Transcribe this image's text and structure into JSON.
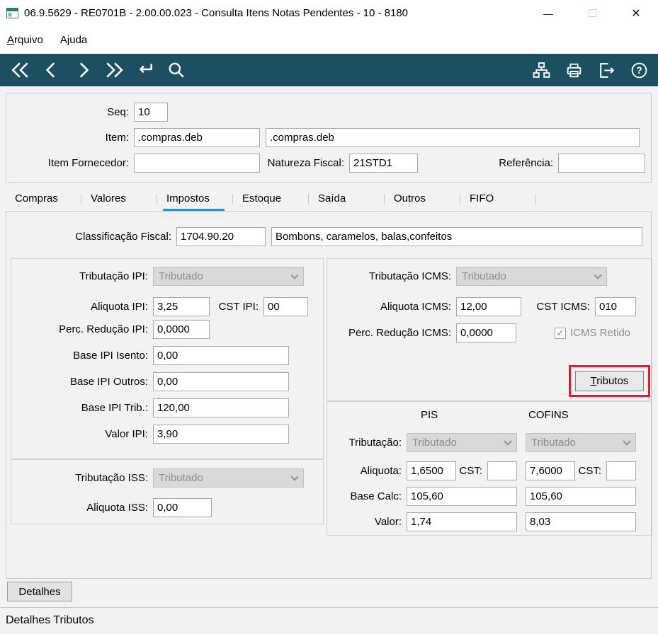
{
  "colors": {
    "toolbar_bg": "#1d4f63",
    "tab_accent": "#1e97d4",
    "annotation": "#e8192c"
  },
  "window": {
    "title": "06.9.5629 - RE0701B - 2.00.00.023 - Consulta Itens Notas Pendentes - 10 - 8180",
    "minimize": "—",
    "close": "✕"
  },
  "menu": {
    "arquivo": {
      "key": "A",
      "rest": "rquivo"
    },
    "ajuda": {
      "pre": "A",
      "key": "j",
      "rest": "uda"
    }
  },
  "toolbar": {
    "left_icons": [
      "first-record-icon",
      "prev-record-icon",
      "next-record-icon",
      "last-record-icon",
      "go-to-icon",
      "search-icon"
    ],
    "right_icons": [
      "hierarchy-icon",
      "print-icon",
      "exit-icon",
      "help-icon"
    ]
  },
  "header": {
    "seq_label": "Seq:",
    "seq_value": "10",
    "item_label": "Item:",
    "item_code": ".compras.deb",
    "item_desc": ".compras.deb",
    "item_fornecedor_label": "Item Fornecedor:",
    "item_fornecedor_value": "",
    "natureza_label": "Natureza Fiscal:",
    "natureza_value": "21STD1",
    "referencia_label": "Referência:",
    "referencia_value": ""
  },
  "tabs": {
    "items": [
      {
        "label": "Compras"
      },
      {
        "label": "Valores"
      },
      {
        "label": "Impostos",
        "active": true
      },
      {
        "label": "Estoque"
      },
      {
        "label": "Saída"
      },
      {
        "label": "Outros"
      },
      {
        "label": "FIFO"
      }
    ]
  },
  "impostos": {
    "classificacao_label": "Classificação Fiscal:",
    "classificacao_code": "1704.90.20",
    "classificacao_desc": "Bombons, caramelos, balas,confeitos",
    "ipi": {
      "tributacao_label": "Tributação IPI:",
      "tributacao_value": "Tributado",
      "aliquota_label": "Aliquota IPI:",
      "aliquota_value": "3,25",
      "cst_label": "CST IPI:",
      "cst_value": "00",
      "perc_reducao_label": "Perc. Redução IPI:",
      "perc_reducao_value": "0,0000",
      "base_isento_label": "Base IPI Isento:",
      "base_isento_value": "0,00",
      "base_outros_label": "Base IPI Outros:",
      "base_outros_value": "0,00",
      "base_trib_label": "Base IPI Trib.:",
      "base_trib_value": "120,00",
      "valor_label": "Valor IPI:",
      "valor_value": "3,90"
    },
    "iss": {
      "tributacao_label": "Tributação ISS:",
      "tributacao_value": "Tributado",
      "aliquota_label": "Aliquota ISS:",
      "aliquota_value": "0,00"
    },
    "icms": {
      "tributacao_label": "Tributação ICMS:",
      "tributacao_value": "Tributado",
      "aliquota_label": "Aliquota ICMS:",
      "aliquota_value": "12,00",
      "cst_label": "CST ICMS:",
      "cst_value": "010",
      "perc_reducao_label": "Perc. Redução ICMS:",
      "perc_reducao_value": "0,0000",
      "retido_check": "✓",
      "retido_label": "ICMS Retido",
      "tributos": {
        "key": "T",
        "rest": "ributos"
      }
    },
    "pis_cofins": {
      "pis_header": "PIS",
      "cofins_header": "COFINS",
      "tributacao_label": "Tributação:",
      "pis_tributacao": "Tributado",
      "cofins_tributacao": "Tributado",
      "aliquota_label": "Aliquota:",
      "pis_aliquota": "1,6500",
      "cofins_aliquota": "7,6000",
      "cst_label": "CST:",
      "pis_cst": "",
      "cofins_cst": "",
      "base_label": "Base Calc:",
      "pis_base": "105,60",
      "cofins_base": "105,60",
      "valor_label": "Valor:",
      "pis_valor": "1,74",
      "cofins_valor": "8,03"
    }
  },
  "footer": {
    "detalhes_button": "Detalhes",
    "status_text": "Detalhes Tributos"
  }
}
